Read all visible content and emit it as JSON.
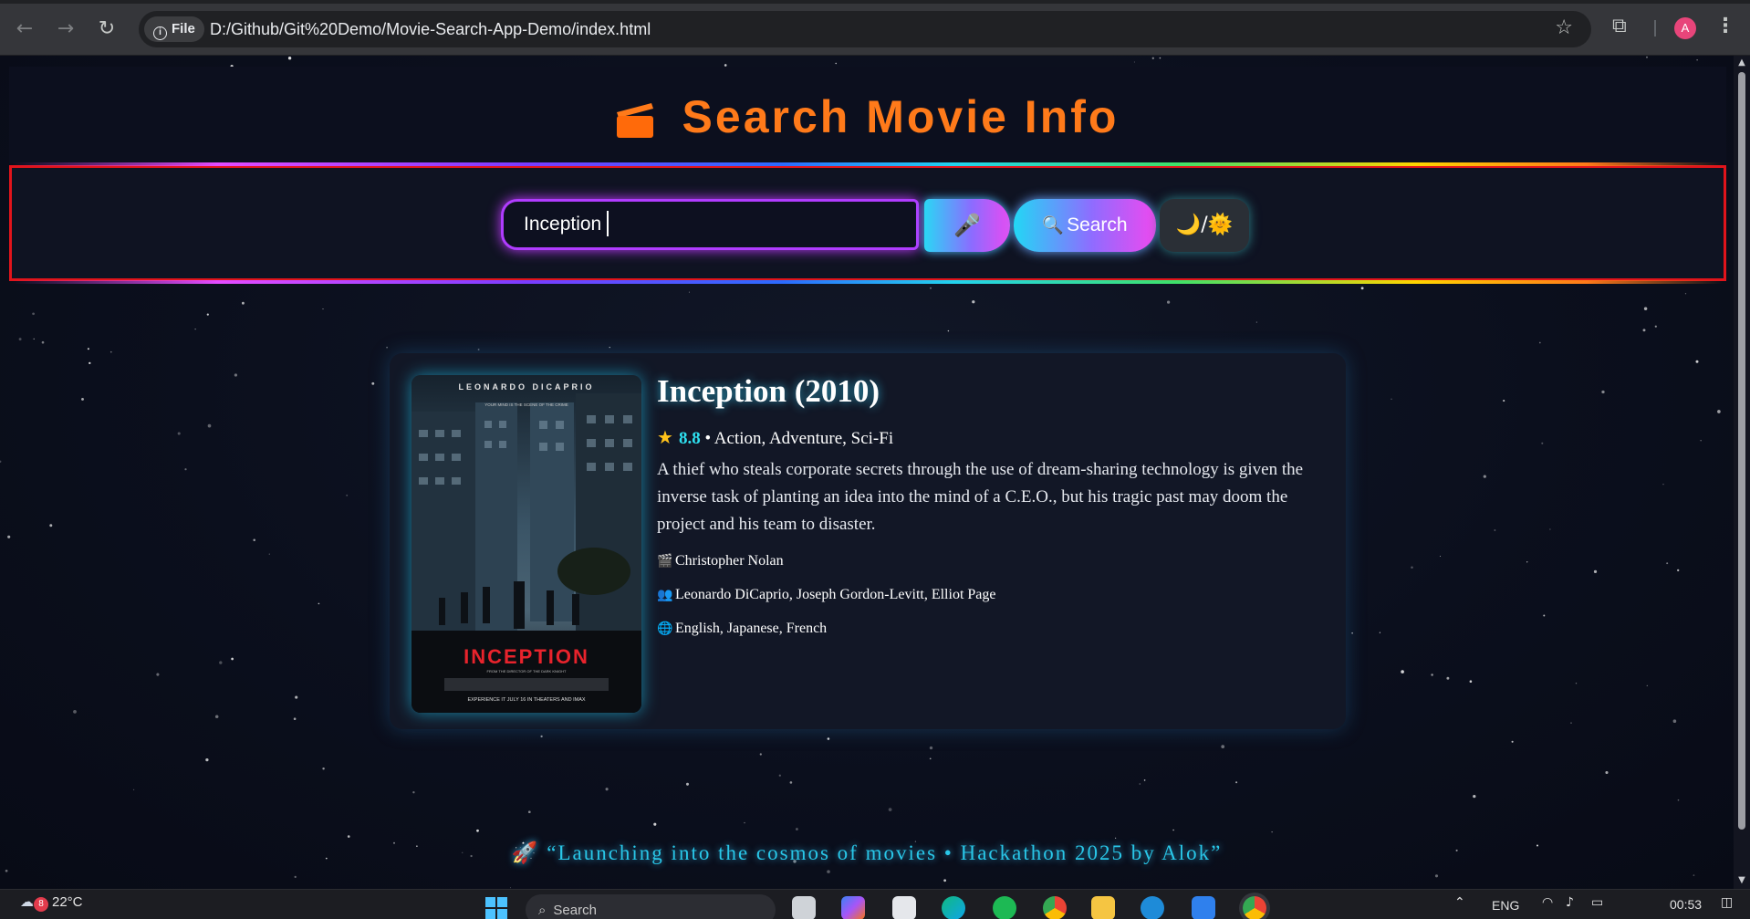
{
  "browser": {
    "site_chip": "File",
    "url": "D:/Github/Git%20Demo/Movie-Search-App-Demo/index.html",
    "profile_initial": "A",
    "icons": [
      "back-icon",
      "forward-icon",
      "reload-icon",
      "info-icon",
      "star-icon",
      "extensions-icon",
      "kebab-menu-icon"
    ]
  },
  "header": {
    "title": "Search Movie Info",
    "icon": "clapperboard-icon",
    "title_color": "#ff7a1a"
  },
  "search": {
    "value": "Inception",
    "mic_icon": "🎤",
    "search_icon": "🔍",
    "search_label": "Search",
    "theme_moon": "🌙",
    "theme_sep": "/",
    "theme_sun": "🌞"
  },
  "movie": {
    "title": "Inception (2010)",
    "rating": "8.8",
    "genres": "• Action, Adventure, Sci-Fi",
    "plot": "A thief who steals corporate secrets through the use of dream-sharing technology is given the inverse task of planting an idea into the mind of a C.E.O., but his tragic past may doom the project and his team to disaster.",
    "director": "Christopher Nolan",
    "cast": "Leonardo DiCaprio, Joseph Gordon-Levitt, Elliot Page",
    "languages": "English, Japanese, French",
    "poster": {
      "top_text": "LEONARDO DICAPRIO",
      "tagline": "YOUR MIND IS THE SCENE OF THE CRIME",
      "title": "INCEPTION",
      "sub": "FROM THE DIRECTOR OF THE DARK KNIGHT",
      "bottom": "EXPERIENCE IT JULY 16 IN THEATERS AND IMAX"
    }
  },
  "footer": {
    "rocket": "🚀",
    "quote": "“Launching into the cosmos of movies • Hackathon 2025 by Alok”"
  },
  "taskbar": {
    "weather_badge": "8",
    "temperature": "22°C",
    "search_placeholder": "Search",
    "language": "ENG",
    "time": "00:53"
  },
  "colors": {
    "accent_orange": "#ff7a1a",
    "accent_cyan": "#29c7e8",
    "accent_purple": "#b03cff",
    "panel_border_red": "#e1141b"
  }
}
